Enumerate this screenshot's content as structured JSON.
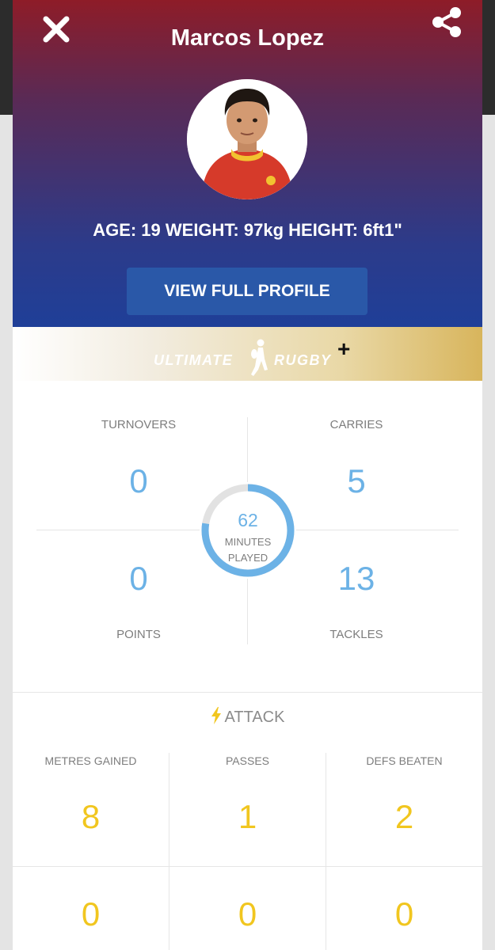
{
  "player": {
    "name": "Marcos Lopez",
    "stats_line": "AGE: 19 WEIGHT: 97kg HEIGHT: 6ft1\""
  },
  "header": {
    "profile_button_label": "VIEW FULL PROFILE",
    "colors": {
      "top": "#8e1c28",
      "bottom": "#1f3f98",
      "button": "#2a58a8"
    }
  },
  "banner": {
    "brand_left": "ULTIMATE",
    "brand_right": "RUGBY",
    "brand_plus": "+"
  },
  "summary": {
    "turnovers": {
      "label": "TURNOVERS",
      "value": "0"
    },
    "carries": {
      "label": "CARRIES",
      "value": "5"
    },
    "points": {
      "label": "POINTS",
      "value": "0"
    },
    "tackles": {
      "label": "TACKLES",
      "value": "13"
    },
    "minutes": {
      "value": "62",
      "caption_line1": "MINUTES",
      "caption_line2": "PLAYED",
      "ring_fraction": 0.775
    },
    "accent_color": "#6cb2e6"
  },
  "attack": {
    "title": "ATTACK",
    "icon": "lightning-icon",
    "accent_color": "#f1c61f",
    "columns": [
      {
        "label": "METRES GAINED",
        "value": "8"
      },
      {
        "label": "PASSES",
        "value": "1"
      },
      {
        "label": "DEFS BEATEN",
        "value": "2"
      }
    ],
    "second_row": [
      "0",
      "0",
      "0"
    ]
  }
}
